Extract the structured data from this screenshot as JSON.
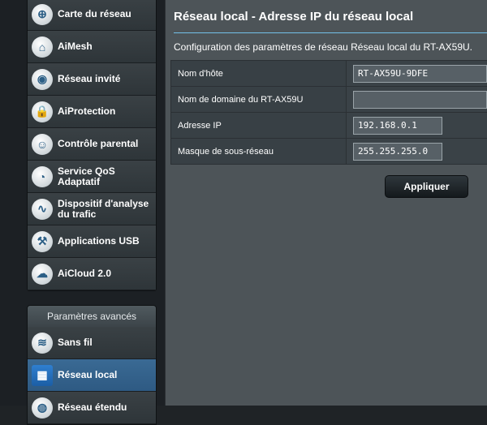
{
  "sidebar": {
    "items": [
      {
        "label": "Carte du réseau",
        "icon": "network-map-icon",
        "glyph": "⊕"
      },
      {
        "label": "AiMesh",
        "icon": "aimesh-icon",
        "glyph": "⌂"
      },
      {
        "label": "Réseau invité",
        "icon": "guest-network-icon",
        "glyph": "◉"
      },
      {
        "label": "AiProtection",
        "icon": "aiprotection-icon",
        "glyph": "🔒"
      },
      {
        "label": "Contrôle parental",
        "icon": "parental-control-icon",
        "glyph": "☺"
      },
      {
        "label": "Service QoS Adaptatif",
        "icon": "qos-icon",
        "glyph": "◔"
      },
      {
        "label": "Dispositif d'analyse du trafic",
        "icon": "traffic-analyzer-icon",
        "glyph": "∿"
      },
      {
        "label": "Applications USB",
        "icon": "usb-icon",
        "glyph": "⚒"
      },
      {
        "label": "AiCloud 2.0",
        "icon": "aicloud-icon",
        "glyph": "☁"
      }
    ],
    "advanced": {
      "header": "Paramètres avancés",
      "items": [
        {
          "label": "Sans fil",
          "icon": "wireless-icon",
          "glyph": "≋"
        },
        {
          "label": "Réseau local",
          "icon": "lan-icon",
          "glyph": "▦",
          "active": true
        },
        {
          "label": "Réseau étendu",
          "icon": "wan-icon",
          "glyph": "◍"
        }
      ]
    }
  },
  "main": {
    "title": "Réseau local - Adresse IP du réseau local",
    "description": "Configuration des paramètres de réseau Réseau local du RT-AX59U.",
    "fields": [
      {
        "label": "Nom d'hôte",
        "value": "RT-AX59U-9DFE"
      },
      {
        "label": "Nom de domaine du RT-AX59U",
        "value": ""
      },
      {
        "label": "Adresse IP",
        "value": "192.168.0.1"
      },
      {
        "label": "Masque de sous-réseau",
        "value": "255.255.255.0"
      }
    ],
    "apply_label": "Appliquer"
  },
  "colors": {
    "accent_rule": "#73c0e8",
    "active_item": "#2e5a83"
  }
}
